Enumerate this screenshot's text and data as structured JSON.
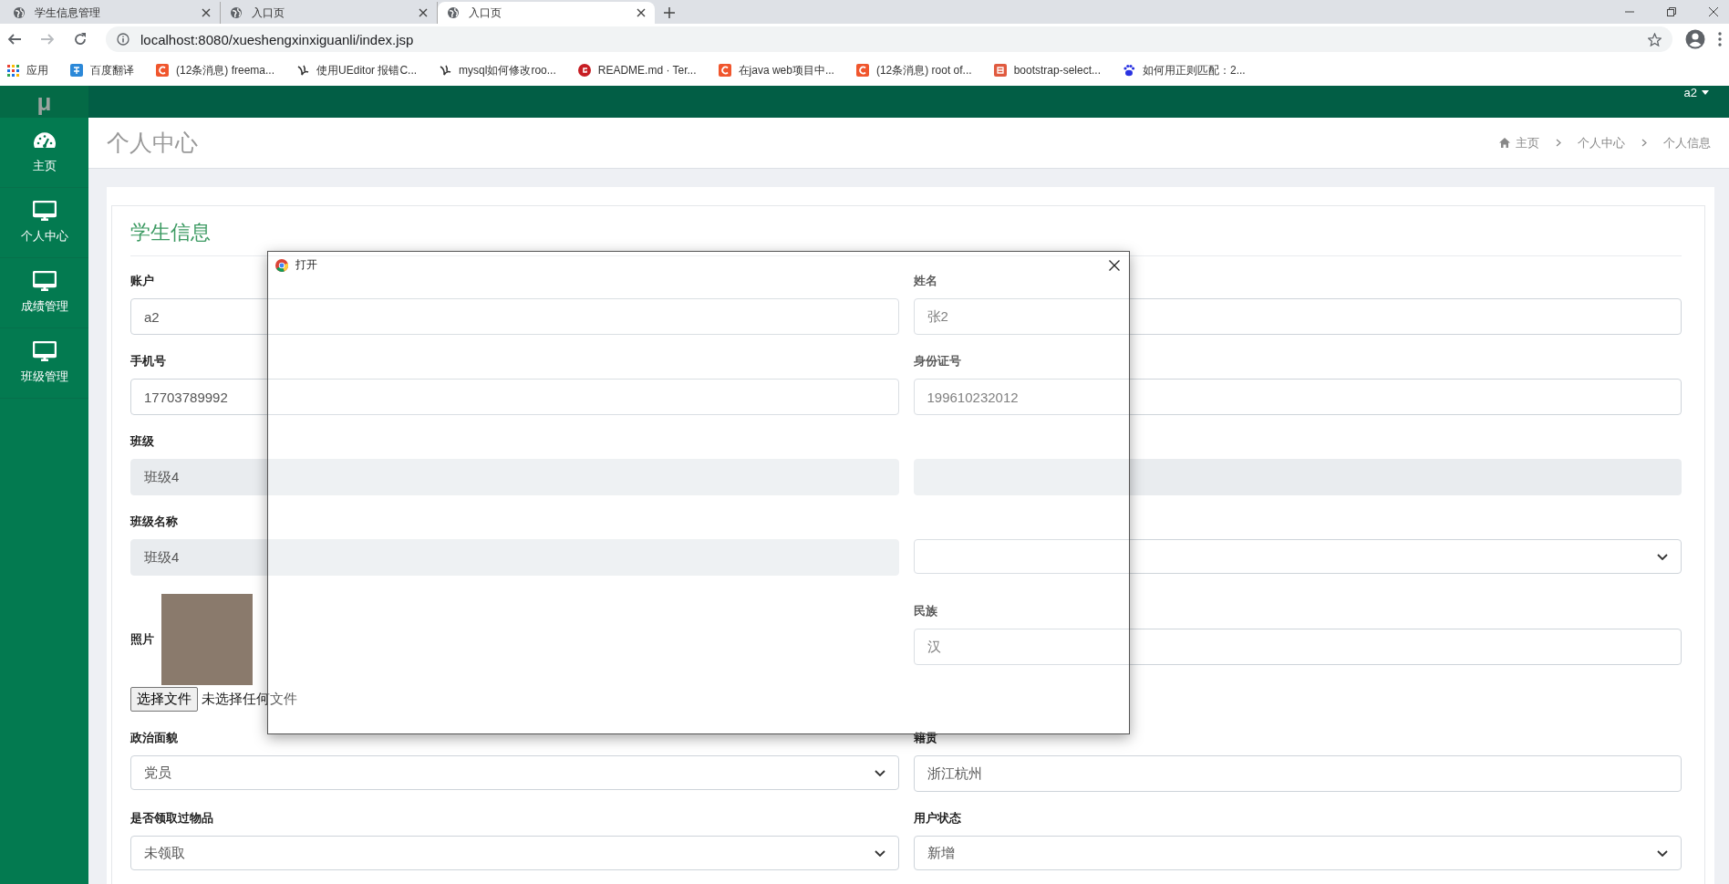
{
  "browser": {
    "tabs": [
      {
        "title": "学生信息管理",
        "selected": false
      },
      {
        "title": "入口页",
        "selected": false
      },
      {
        "title": "入口页",
        "selected": true
      }
    ],
    "nav": [
      {
        "kind": "back",
        "disabled": false
      },
      {
        "kind": "forward",
        "disabled": true
      },
      {
        "kind": "reload",
        "disabled": false
      }
    ],
    "url": "localhost:8080/xueshengxinxiguanli/index.jsp",
    "bookmarks": [
      {
        "kind": "apps",
        "label": "应用"
      },
      {
        "kind": "translate",
        "label": "百度翻译"
      },
      {
        "kind": "csdn",
        "label": "(12条消息) freema..."
      },
      {
        "kind": "swirl",
        "label": "使用UEditor 报错C..."
      },
      {
        "kind": "swirl",
        "label": "mysql如何修改roo..."
      },
      {
        "kind": "gitee",
        "label": "README.md · Ter..."
      },
      {
        "kind": "csdn",
        "label": "在java web项目中..."
      },
      {
        "kind": "csdn",
        "label": "(12条消息) root of..."
      },
      {
        "kind": "jianshu",
        "label": "bootstrap-select..."
      },
      {
        "kind": "baidu",
        "label": "如何用正则匹配：2..."
      }
    ]
  },
  "app": {
    "logo": "μ",
    "user": "a2",
    "sidebar": [
      {
        "kind": "dashboard",
        "label": "主页"
      },
      {
        "kind": "monitor",
        "label": "个人中心"
      },
      {
        "kind": "monitor",
        "label": "成绩管理"
      },
      {
        "kind": "monitor",
        "label": "班级管理"
      }
    ],
    "page_title": "个人中心",
    "breadcrumb": [
      "主页",
      "个人中心",
      "个人信息"
    ],
    "card_title": "学生信息",
    "form_rows": [
      [
        {
          "kind": "text",
          "label": "账户",
          "value": "a2"
        },
        {
          "kind": "text",
          "label": "姓名",
          "value": "张2"
        }
      ],
      [
        {
          "kind": "text",
          "label": "手机号",
          "value": "17703789992"
        },
        {
          "kind": "text",
          "label": "身份证号",
          "value": "199610232012"
        }
      ],
      [
        {
          "kind": "readonly",
          "label": "班级",
          "value": "班级4"
        },
        {
          "kind": "readonly"
        }
      ],
      [
        {
          "kind": "readonly",
          "label": "班级名称",
          "value": "班级4"
        },
        {
          "kind": "select"
        }
      ],
      [
        {
          "kind": "photo",
          "label": "照片",
          "button": "选择文件",
          "status": "未选择任何文件"
        },
        {
          "kind": "text",
          "label": "民族",
          "value": "汉"
        }
      ],
      [
        {
          "kind": "select",
          "label": "政治面貌",
          "value": "党员"
        },
        {
          "kind": "text",
          "label": "籍贯",
          "value": "浙江杭州"
        }
      ],
      [
        {
          "kind": "select",
          "label": "是否领取过物品",
          "value": "未领取"
        },
        {
          "kind": "select",
          "label": "用户状态",
          "value": "新增"
        }
      ]
    ]
  },
  "dialog": {
    "title": "打开"
  }
}
